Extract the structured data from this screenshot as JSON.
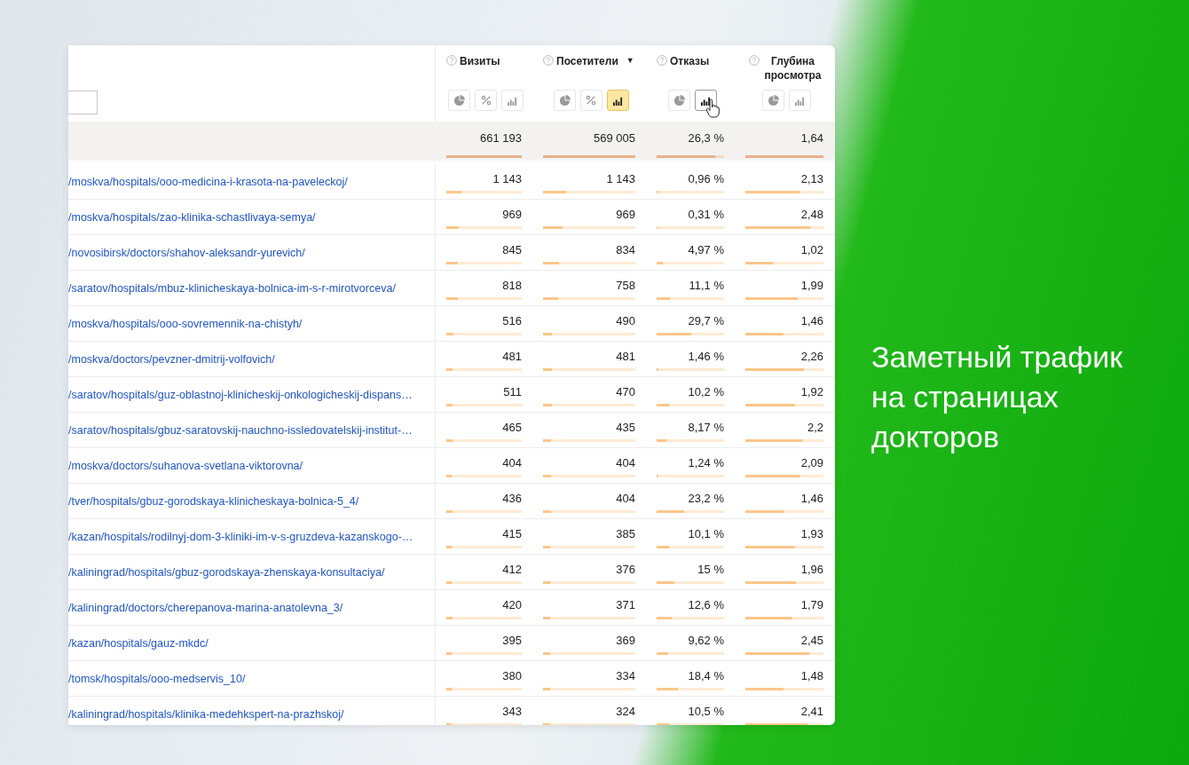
{
  "table": {
    "columns": [
      {
        "title": "Визиты",
        "buttons": [
          {
            "kind": "pie",
            "selected": false,
            "hovered": false
          },
          {
            "kind": "percent",
            "selected": false,
            "hovered": false
          },
          {
            "kind": "bars",
            "selected": false,
            "hovered": false
          }
        ]
      },
      {
        "title": "Посетители",
        "sort_mark": "▼",
        "buttons": [
          {
            "kind": "pie",
            "selected": false,
            "hovered": false
          },
          {
            "kind": "percent",
            "selected": false,
            "hovered": false
          },
          {
            "kind": "bars",
            "selected": true,
            "hovered": false
          }
        ]
      },
      {
        "title": "Отказы",
        "buttons": [
          {
            "kind": "pie",
            "selected": false,
            "hovered": false
          },
          {
            "kind": "bars",
            "selected": false,
            "hovered": true
          }
        ]
      },
      {
        "title": "Глубина просмотра",
        "buttons": [
          {
            "kind": "pie",
            "selected": false,
            "hovered": false
          },
          {
            "kind": "bars",
            "selected": false,
            "hovered": false
          }
        ]
      }
    ],
    "totals": [
      {
        "value": "661 193",
        "level": 1
      },
      {
        "value": "569 005",
        "level": 1
      },
      {
        "value": "26,3 %",
        "level": 0.87
      },
      {
        "value": "1,64",
        "level": 1
      }
    ],
    "rows": [
      {
        "url": "/moskva/hospitals/ooo-medicina-i-krasota-na-paveleckoj/",
        "cells": [
          {
            "value": "1 143",
            "level": 0.2
          },
          {
            "value": "1 143",
            "level": 0.25
          },
          {
            "value": "0,96 %",
            "level": 0.02
          },
          {
            "value": "2,13",
            "level": 0.71
          }
        ]
      },
      {
        "url": "/moskva/hospitals/zao-klinika-schastlivaya-semya/",
        "cells": [
          {
            "value": "969",
            "level": 0.17
          },
          {
            "value": "969",
            "level": 0.21
          },
          {
            "value": "0,31 %",
            "level": 0.01
          },
          {
            "value": "2,48",
            "level": 0.83
          }
        ]
      },
      {
        "url": "/novosibirsk/doctors/shahov-aleksandr-yurevich/",
        "cells": [
          {
            "value": "845",
            "level": 0.15
          },
          {
            "value": "834",
            "level": 0.17
          },
          {
            "value": "4,97 %",
            "level": 0.09
          },
          {
            "value": "1,02",
            "level": 0.35
          }
        ]
      },
      {
        "url": "/saratov/hospitals/mbuz-klinicheskaya-bolnica-im-s-r-mirotvorceva/",
        "cells": [
          {
            "value": "818",
            "level": 0.15
          },
          {
            "value": "758",
            "level": 0.16
          },
          {
            "value": "11,1 %",
            "level": 0.2
          },
          {
            "value": "1,99",
            "level": 0.67
          }
        ]
      },
      {
        "url": "/moskva/hospitals/ooo-sovremennik-na-chistyh/",
        "cells": [
          {
            "value": "516",
            "level": 0.09
          },
          {
            "value": "490",
            "level": 0.1
          },
          {
            "value": "29,7 %",
            "level": 0.51
          },
          {
            "value": "1,46",
            "level": 0.49
          }
        ]
      },
      {
        "url": "/moskva/doctors/pevzner-dmitrij-volfovich/",
        "cells": [
          {
            "value": "481",
            "level": 0.085
          },
          {
            "value": "481",
            "level": 0.1
          },
          {
            "value": "1,46 %",
            "level": 0.03
          },
          {
            "value": "2,26",
            "level": 0.75
          }
        ]
      },
      {
        "url": "/saratov/hospitals/guz-oblastnoj-klinicheskij-onkologicheskij-dispans…",
        "cells": [
          {
            "value": "511",
            "level": 0.085
          },
          {
            "value": "470",
            "level": 0.1
          },
          {
            "value": "10,2 %",
            "level": 0.18
          },
          {
            "value": "1,92",
            "level": 0.64
          }
        ]
      },
      {
        "url": "/saratov/hospitals/gbuz-saratovskij-nauchno-issledovatelskij-institut-…",
        "cells": [
          {
            "value": "465",
            "level": 0.085
          },
          {
            "value": "435",
            "level": 0.09
          },
          {
            "value": "8,17 %",
            "level": 0.14
          },
          {
            "value": "2,2",
            "level": 0.73
          }
        ]
      },
      {
        "url": "/moskva/doctors/suhanova-svetlana-viktorovna/",
        "cells": [
          {
            "value": "404",
            "level": 0.07
          },
          {
            "value": "404",
            "level": 0.09
          },
          {
            "value": "1,24 %",
            "level": 0.03
          },
          {
            "value": "2,09",
            "level": 0.7
          }
        ]
      },
      {
        "url": "/tver/hospitals/gbuz-gorodskaya-klinicheskaya-bolnica-5_4/",
        "cells": [
          {
            "value": "436",
            "level": 0.085
          },
          {
            "value": "404",
            "level": 0.09
          },
          {
            "value": "23,2 %",
            "level": 0.41
          },
          {
            "value": "1,46",
            "level": 0.49
          }
        ]
      },
      {
        "url": "/kazan/hospitals/rodilnyj-dom-3-kliniki-im-v-s-gruzdeva-kazanskogo-…",
        "cells": [
          {
            "value": "415",
            "level": 0.07
          },
          {
            "value": "385",
            "level": 0.08
          },
          {
            "value": "10,1 %",
            "level": 0.18
          },
          {
            "value": "1,93",
            "level": 0.64
          }
        ]
      },
      {
        "url": "/kaliningrad/hospitals/gbuz-gorodskaya-zhenskaya-konsultaciya/",
        "cells": [
          {
            "value": "412",
            "level": 0.07
          },
          {
            "value": "376",
            "level": 0.08
          },
          {
            "value": "15 %",
            "level": 0.26
          },
          {
            "value": "1,96",
            "level": 0.65
          }
        ]
      },
      {
        "url": "/kaliningrad/doctors/cherepanova-marina-anatolevna_3/",
        "cells": [
          {
            "value": "420",
            "level": 0.085
          },
          {
            "value": "371",
            "level": 0.08
          },
          {
            "value": "12,6 %",
            "level": 0.22
          },
          {
            "value": "1,79",
            "level": 0.6
          }
        ]
      },
      {
        "url": "/kazan/hospitals/gauz-mkdc/",
        "cells": [
          {
            "value": "395",
            "level": 0.07
          },
          {
            "value": "369",
            "level": 0.08
          },
          {
            "value": "9,62 %",
            "level": 0.17
          },
          {
            "value": "2,45",
            "level": 0.82
          }
        ]
      },
      {
        "url": "/tomsk/hospitals/ooo-medservis_10/",
        "cells": [
          {
            "value": "380",
            "level": 0.07
          },
          {
            "value": "334",
            "level": 0.08
          },
          {
            "value": "18,4 %",
            "level": 0.32
          },
          {
            "value": "1,48",
            "level": 0.49
          }
        ]
      },
      {
        "url": "/kaliningrad/hospitals/klinika-medehkspert-na-prazhskoj/",
        "cells": [
          {
            "value": "343",
            "level": 0.07
          },
          {
            "value": "324",
            "level": 0.08
          },
          {
            "value": "10,5 %",
            "level": 0.19
          },
          {
            "value": "2,41",
            "level": 0.8
          }
        ]
      }
    ]
  },
  "headline": "Заметный трафик на страницах докторов"
}
